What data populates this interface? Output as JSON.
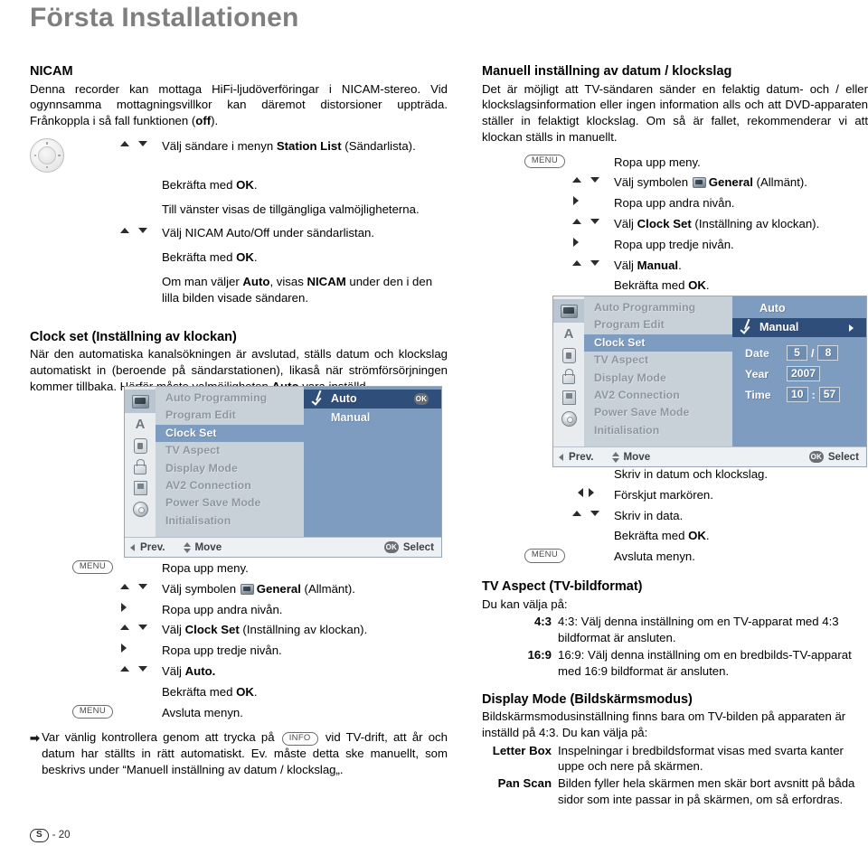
{
  "page": {
    "title": "Första Installationen",
    "footer_lang": "S",
    "footer_page": "- 20"
  },
  "left": {
    "nicam": {
      "heading": "NICAM",
      "body": "Denna recorder kan mottaga HiFi-ljudöverföringar i NICAM-stereo. Vid ogynnsamma mottagningsvillkor kan däremot distorsioner uppträda. Frånkoppla i så fall funktionen (off)."
    },
    "nicam_steps": [
      {
        "keys": "updown",
        "text_parts": [
          "Välj sändare i menyn ",
          "Station List",
          " (Sändarlista)."
        ]
      },
      {
        "keys": "none",
        "text_parts": [
          "Bekräfta med ",
          "OK",
          "."
        ]
      },
      {
        "keys": "none",
        "text_parts": [
          "Till vänster visas de tillgängliga valmöjligheterna.",
          "",
          ""
        ]
      },
      {
        "keys": "updown",
        "text_parts": [
          "Välj NICAM Auto/Off under sändarlistan.",
          "",
          ""
        ]
      },
      {
        "keys": "none",
        "text_parts": [
          "Bekräfta med ",
          "OK",
          "."
        ]
      },
      {
        "keys": "none",
        "text_parts": [
          "Om man väljer Auto, visas NICAM under den i den lilla bilden visade sändaren.",
          "",
          ""
        ]
      }
    ],
    "clockset": {
      "heading": "Clock set (Inställning av klockan)",
      "body": "När den automatiska kanalsökningen är avslutad, ställs datum och klockslag automatiskt in (beroende på sändarstationen), likaså när strömförsörjningen kommer tillbaka. Härför måste valmöjligheten Auto vara inställd."
    },
    "menu_steps": [
      {
        "badge": "MENU",
        "text": "Ropa upp meny."
      },
      {
        "badge": "",
        "text": "Välj symbolen  General (Allmänt)."
      },
      {
        "badge": "",
        "text": "Ropa upp andra nivån."
      },
      {
        "badge": "",
        "text": "Välj Clock Set (Inställning av klockan)."
      },
      {
        "badge": "",
        "text": "Ropa upp tredje nivån."
      },
      {
        "badge": "",
        "text": "Välj Auto."
      },
      {
        "badge": "",
        "text": "Bekräfta med OK."
      },
      {
        "badge": "MENU",
        "text": "Avsluta menyn."
      }
    ],
    "note": {
      "marker": "→",
      "part1": "Var vänlig kontrollera genom att trycka på ",
      "key": "INFO",
      "part2": " vid TV-drift, att år och datum har ställts in rätt automatiskt. Ev. måste detta ske manuellt, som beskrivs under “Manuell inställning av datum / klockslag“."
    }
  },
  "right": {
    "manual_clock": {
      "heading": "Manuell inställning av datum / klockslag",
      "body": "Det är möjligt att TV-sändaren sänder en felaktig datum- och / eller klockslagsinformation eller ingen information alls och att DVD-apparaten ställer in felaktigt klockslag. Om så är fallet, rekommenderar vi att klockan ställs in manuellt."
    },
    "steps_before": [
      {
        "badge": "MENU",
        "text": "Ropa upp meny."
      },
      {
        "badge": "",
        "text": "Välj symbolen  General (Allmänt)."
      },
      {
        "badge": "",
        "text": "Ropa upp andra nivån."
      },
      {
        "badge": "",
        "text": "Välj Clock Set (Inställning av klockan)."
      },
      {
        "badge": "",
        "text": "Ropa upp tredje nivån."
      },
      {
        "badge": "",
        "text": "Välj Manual."
      },
      {
        "badge": "",
        "text": "Bekräfta med OK."
      }
    ],
    "steps_after": [
      {
        "badge": "",
        "text": "Skriv in datum och klockslag."
      },
      {
        "badge": "",
        "text": "Förskjut markören."
      },
      {
        "badge": "",
        "text": "Skriv in data."
      },
      {
        "badge": "",
        "text": "Bekräfta med OK."
      },
      {
        "badge": "MENU",
        "text": "Avsluta menyn."
      }
    ],
    "tv_aspect": {
      "heading": "TV Aspect (TV-bildformat)",
      "intro": "Du kan välja på:",
      "items": [
        {
          "term": "4:3",
          "desc": "4:3: Välj denna inställning om en TV-apparat med 4:3 bildformat är ansluten."
        },
        {
          "term": "16:9",
          "desc": "16:9: Välj denna inställning om en bredbilds-TV-apparat med 16:9 bildformat är ansluten."
        }
      ]
    },
    "display_mode": {
      "heading": "Display Mode (Bildskärmsmodus)",
      "intro": "Bildskärmsmodusinställning finns bara om TV-bilden på apparaten är inställd på 4:3. Du kan välja på:",
      "items": [
        {
          "term": "Letter Box",
          "desc": "Inspelningar i bredbildsformat visas med svarta kanter uppe och nere på skärmen."
        },
        {
          "term": "Pan Scan",
          "desc": "Bilden fyller hela skärmen men skär bort avsnitt på båda sidor som inte passar in på skärmen, om så erfordras."
        }
      ]
    }
  },
  "osd_left": {
    "menu_items": [
      {
        "label": "Auto Programming",
        "selected": false
      },
      {
        "label": "Program Edit",
        "selected": false
      },
      {
        "label": "Clock Set",
        "selected": true
      },
      {
        "label": "TV Aspect",
        "selected": false
      },
      {
        "label": "Display Mode",
        "selected": false
      },
      {
        "label": "AV2 Connection",
        "selected": false
      },
      {
        "label": "Power Save Mode",
        "selected": false
      },
      {
        "label": "Initialisation",
        "selected": false
      }
    ],
    "options": [
      {
        "label": "Auto",
        "checked": true,
        "highlight": true,
        "badge": "OK",
        "caret": false
      },
      {
        "label": "Manual",
        "checked": false,
        "highlight": false,
        "badge": "",
        "caret": false
      }
    ],
    "footer": {
      "prev": "Prev.",
      "move": "Move",
      "select": "Select",
      "ok_badge": "OK"
    }
  },
  "osd_right": {
    "menu_items": [
      {
        "label": "Auto Programming",
        "selected": false
      },
      {
        "label": "Program Edit",
        "selected": false
      },
      {
        "label": "Clock Set",
        "selected": true
      },
      {
        "label": "TV Aspect",
        "selected": false
      },
      {
        "label": "Display Mode",
        "selected": false
      },
      {
        "label": "AV2 Connection",
        "selected": false
      },
      {
        "label": "Power Save Mode",
        "selected": false
      },
      {
        "label": "Initialisation",
        "selected": false
      }
    ],
    "options": [
      {
        "label": "Auto",
        "checked": false,
        "highlight": false,
        "badge": "",
        "caret": false
      },
      {
        "label": "Manual",
        "checked": true,
        "highlight": true,
        "badge": "",
        "caret": true
      }
    ],
    "fields": [
      {
        "label": "Date",
        "v1": "5",
        "sep": "/",
        "v2": "8"
      },
      {
        "label": "Year",
        "v1": "2007",
        "sep": "",
        "v2": ""
      },
      {
        "label": "Time",
        "v1": "10",
        "sep": ":",
        "v2": "57"
      }
    ],
    "footer": {
      "prev": "Prev.",
      "move": "Move",
      "select": "Select",
      "ok_badge": "OK"
    }
  },
  "labels": {
    "menu_key": "MENU",
    "info_key": "INFO"
  },
  "colors": {
    "title_gray": "#7f7f7f",
    "osd_blue": "#7d9cc0",
    "osd_highlight": "#2f4f7a",
    "osd_list_bg": "#c8d0d8",
    "osd_footer_bg": "#eef1f4"
  }
}
